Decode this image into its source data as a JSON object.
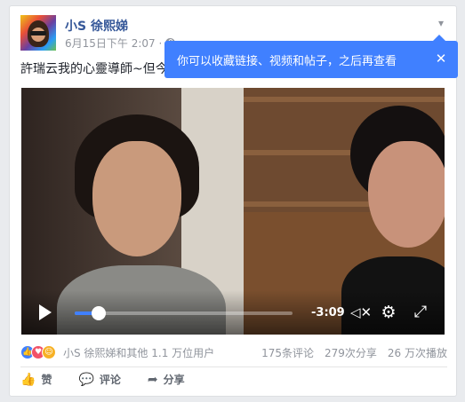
{
  "post": {
    "author": "小S 徐熙娣",
    "timestamp": "6月15日下午 2:07 ·",
    "privacy_icon": "globe-icon",
    "text": "許瑞云我的心靈導師~但今"
  },
  "tooltip": {
    "text": "你可以收藏链接、视频和帖子，之后再查看",
    "close": "✕"
  },
  "video": {
    "progress": 0.11,
    "time_remaining": "-3:09",
    "accent_color": "#4080ff"
  },
  "stats": {
    "reactions": [
      "like",
      "love",
      "haha"
    ],
    "reactors_text": "小S 徐熙娣和其他 1.1 万位用户",
    "comments": "175条评论",
    "shares": "279次分享",
    "views": "26 万次播放"
  },
  "actions": {
    "like": "赞",
    "comment": "评论",
    "share": "分享"
  },
  "colors": {
    "link": "#365899",
    "tooltip_bg": "#4080ff",
    "muted": "#90949c"
  }
}
